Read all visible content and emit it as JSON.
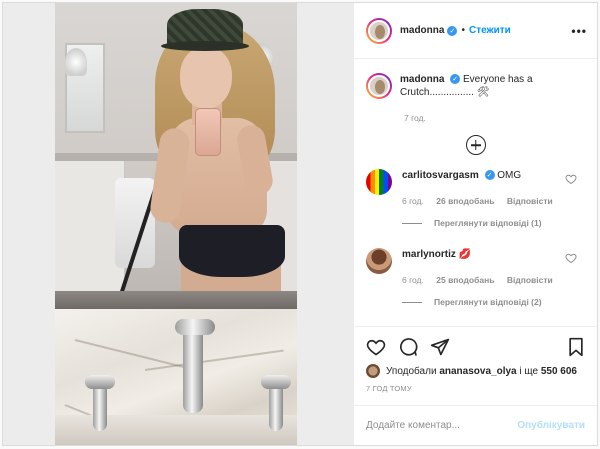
{
  "header": {
    "username": "madonna",
    "separator": "•",
    "follow_label": "Стежити",
    "more_label": "•••"
  },
  "caption": {
    "username": "madonna",
    "text": "Everyone has a Crutch................ 🛠",
    "time": "7 год."
  },
  "comments": [
    {
      "username": "carlitosvargasm",
      "text": "OMG",
      "time": "6 год.",
      "likes": "26 вподобань",
      "reply_label": "Відповісти",
      "view_replies": "Переглянути відповіді (1)"
    },
    {
      "username": "marlynortiz",
      "text": "💋",
      "time": "6 год.",
      "likes": "25 вподобань",
      "reply_label": "Відповісти",
      "view_replies": "Переглянути відповіді (2)"
    }
  ],
  "actions": {
    "liked_by_prefix": "Уподобали",
    "liked_by_user": "ananasova_olya",
    "liked_by_suffix": "і ще",
    "liked_by_count": "550 606",
    "timestamp": "7 ГОД ТОМУ"
  },
  "add_comment": {
    "placeholder": "Додайте коментар...",
    "post_label": "Опублікувати"
  },
  "colors": {
    "link_blue": "#0095f6",
    "verified_blue": "#3897f0",
    "post_disabled": "#b2dffc",
    "muted_text": "#8e8e8e"
  },
  "icons": [
    "more-icon",
    "verified-icon",
    "add-icon",
    "heart-icon",
    "comment-icon",
    "share-icon",
    "bookmark-icon"
  ]
}
